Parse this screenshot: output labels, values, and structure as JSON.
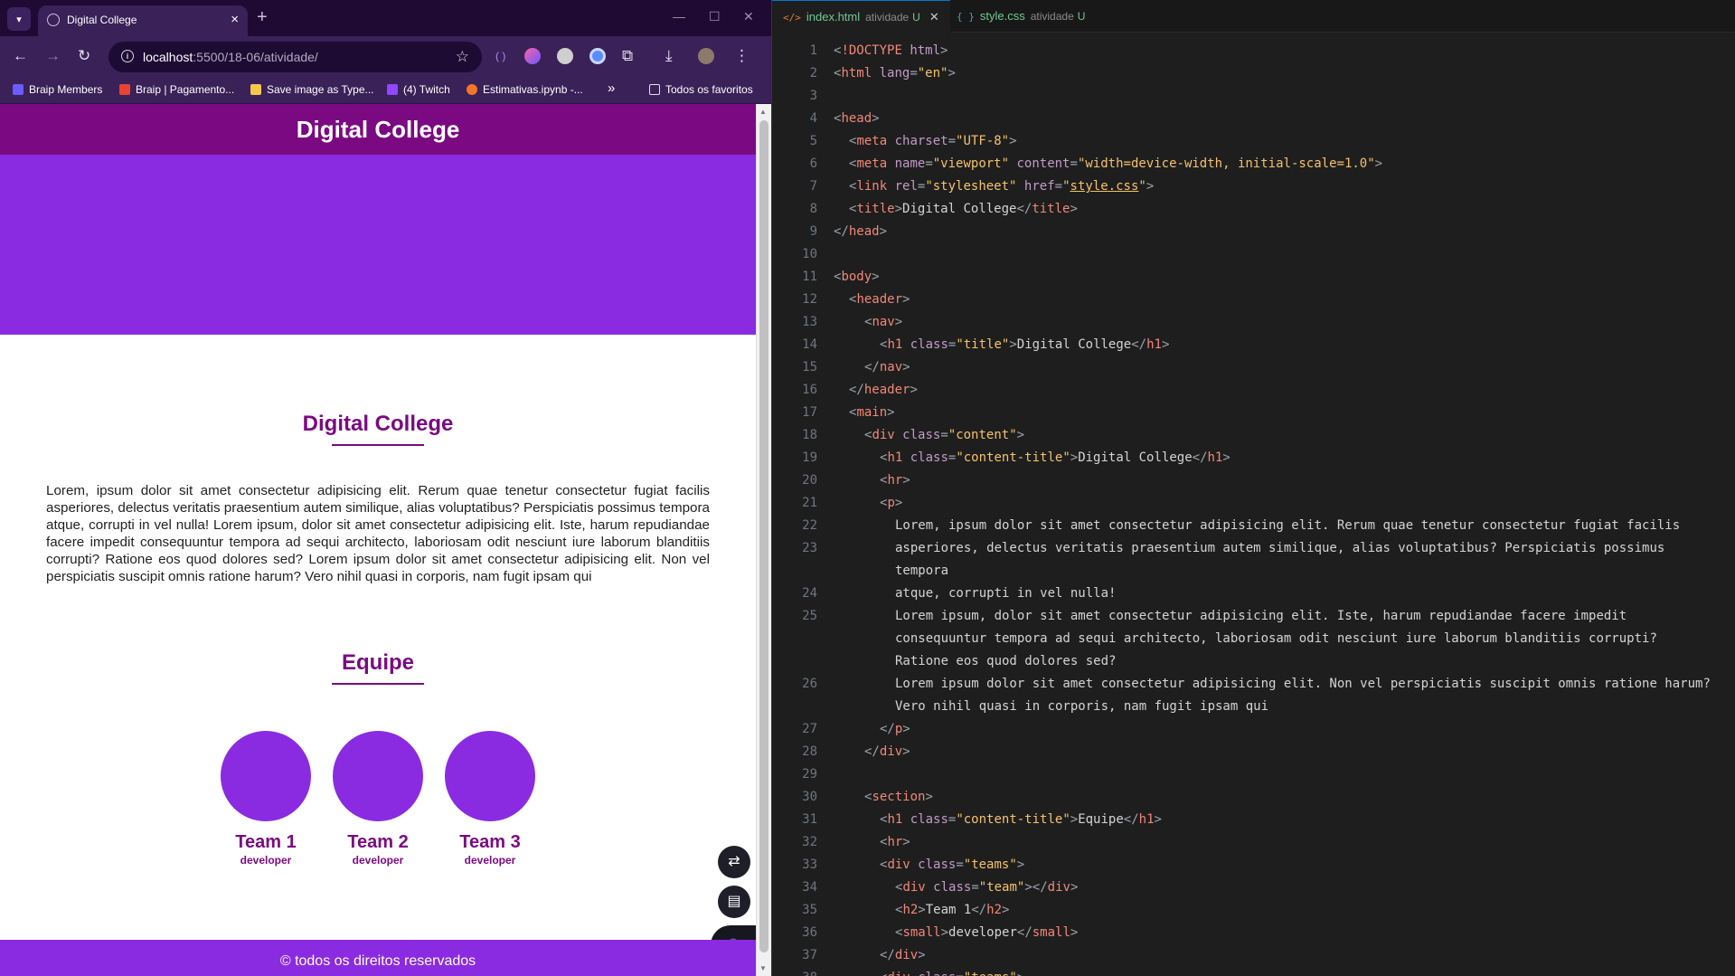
{
  "browser": {
    "tab_title": "Digital College",
    "url_host": "localhost",
    "url_path": ":5500/18-06/atividade/",
    "bookmarks": [
      "Braip Members",
      "Braip | Pagamento...",
      "Save image as Type...",
      "(4) Twitch",
      "Estimativas.ipynb -...",
      "Todos os favoritos"
    ],
    "overflow_label": "»"
  },
  "site": {
    "header_title": "Digital College",
    "content_title": "Digital College",
    "paragraph": "Lorem, ipsum dolor sit amet consectetur adipisicing elit. Rerum quae tenetur consectetur fugiat facilis asperiores, delectus veritatis praesentium autem similique, alias voluptatibus? Perspiciatis possimus tempora atque, corrupti in vel nulla! Lorem ipsum, dolor sit amet consectetur adipisicing elit. Iste, harum repudiandae facere impedit consequuntur tempora ad sequi architecto, laboriosam odit nesciunt iure laborum blanditiis corrupti? Ratione eos quod dolores sed? Lorem ipsum dolor sit amet consectetur adipisicing elit. Non vel perspiciatis suscipit omnis ratione harum? Vero nihil quasi in corporis, nam fugit ipsam qui",
    "team_title": "Equipe",
    "teams": [
      {
        "name": "Team 1",
        "role": "developer"
      },
      {
        "name": "Team 2",
        "role": "developer"
      },
      {
        "name": "Team 3",
        "role": "developer"
      }
    ],
    "footer": "© todos os direitos reservados",
    "colors": {
      "primary": "#7b0a82",
      "accent": "#8a2be2"
    }
  },
  "editor": {
    "tabs": [
      {
        "icon": "</>",
        "name": "index.html",
        "dir": "atividade",
        "status": "U"
      },
      {
        "icon": "{ }",
        "name": "style.css",
        "dir": "atividade",
        "status": "U"
      }
    ],
    "line_numbers": [
      "1",
      "2",
      "3",
      "4",
      "5",
      "6",
      "7",
      "8",
      "9",
      "10",
      "11",
      "12",
      "13",
      "14",
      "15",
      "16",
      "17",
      "18",
      "19",
      "20",
      "21",
      "22",
      "23",
      "",
      "24",
      "25",
      "",
      "",
      "26",
      "",
      "27",
      "28",
      "29",
      "30",
      "31",
      "32",
      "33",
      "34",
      "35",
      "36",
      "37",
      "38"
    ]
  }
}
